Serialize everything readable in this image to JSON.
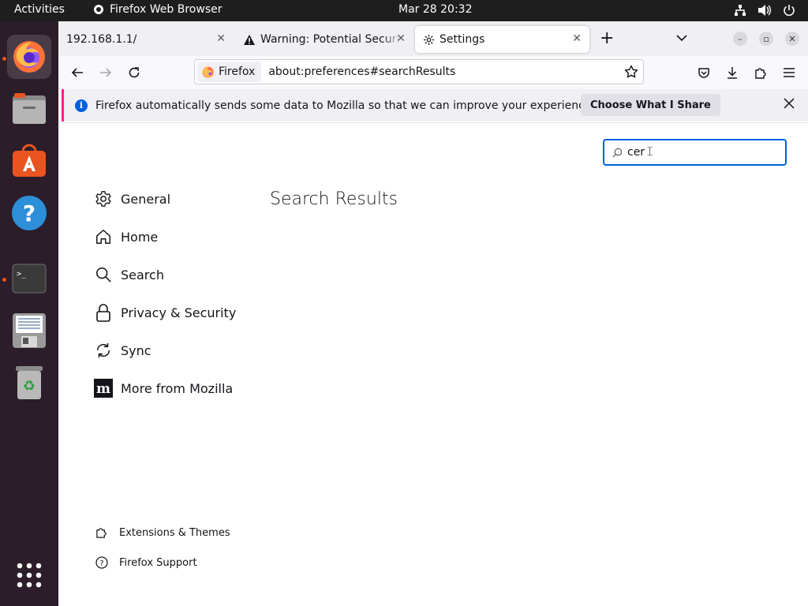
{
  "topbar": {
    "activities": "Activities",
    "app_name": "Firefox Web Browser",
    "clock": "Mar 28  20:32"
  },
  "dock": {
    "items": [
      "firefox-icon",
      "files-icon",
      "software-icon",
      "help-icon",
      "terminal-icon",
      "text-editor-icon",
      "trash-icon",
      "app-grid-icon"
    ]
  },
  "tabs": [
    {
      "title": "192.168.1.1/"
    },
    {
      "title": "Warning: Potential Security Risk Ahead"
    },
    {
      "title": "Settings"
    }
  ],
  "navbar": {
    "identity_label": "Firefox",
    "url": "about:preferences#searchResults"
  },
  "infobar": {
    "message": "Firefox automatically sends some data to Mozilla so that we can improve your experience.",
    "button_label": "Choose What I Share"
  },
  "search": {
    "value": "cer"
  },
  "categories": [
    {
      "label": "General",
      "icon": "gear-icon"
    },
    {
      "label": "Home",
      "icon": "home-icon"
    },
    {
      "label": "Search",
      "icon": "search-icon"
    },
    {
      "label": "Privacy & Security",
      "icon": "lock-icon"
    },
    {
      "label": "Sync",
      "icon": "sync-icon"
    },
    {
      "label": "More from Mozilla",
      "icon": "mozilla-icon"
    }
  ],
  "main": {
    "title": "Search Results"
  },
  "footer": {
    "extensions_label": "Extensions & Themes",
    "support_label": "Firefox Support"
  },
  "colors": {
    "accent": "#0061e0",
    "infobar_border": "#ff1f8e",
    "ubuntu_orange": "#e95420"
  }
}
